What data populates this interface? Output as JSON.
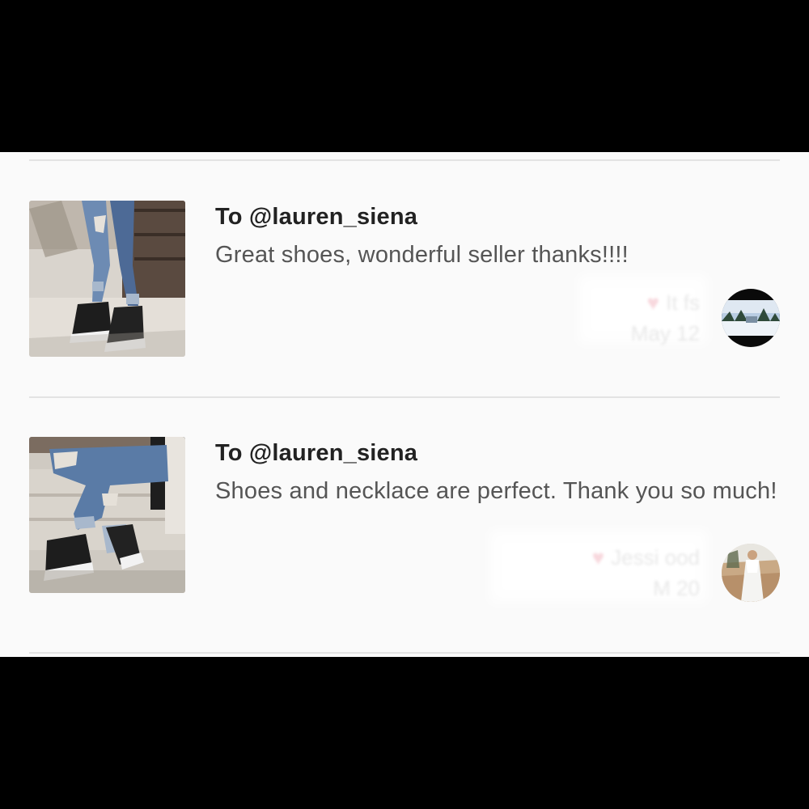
{
  "reviews": [
    {
      "recipient": "To @lauren_siena",
      "message": "Great shoes, wonderful seller thanks!!!!",
      "reviewer": "It  fs",
      "date": "May 12",
      "icon": "heart-icon"
    },
    {
      "recipient": "To @lauren_siena",
      "message": "Shoes and necklace are perfect. Thank you so much!",
      "reviewer": "Jessi  ood",
      "date": "M  20",
      "icon": "heart-icon"
    }
  ],
  "colors": {
    "background": "#fafafa",
    "frame": "#000000",
    "divider": "#e3e3e3",
    "recipient_text": "#222222",
    "message_text": "#555555"
  }
}
